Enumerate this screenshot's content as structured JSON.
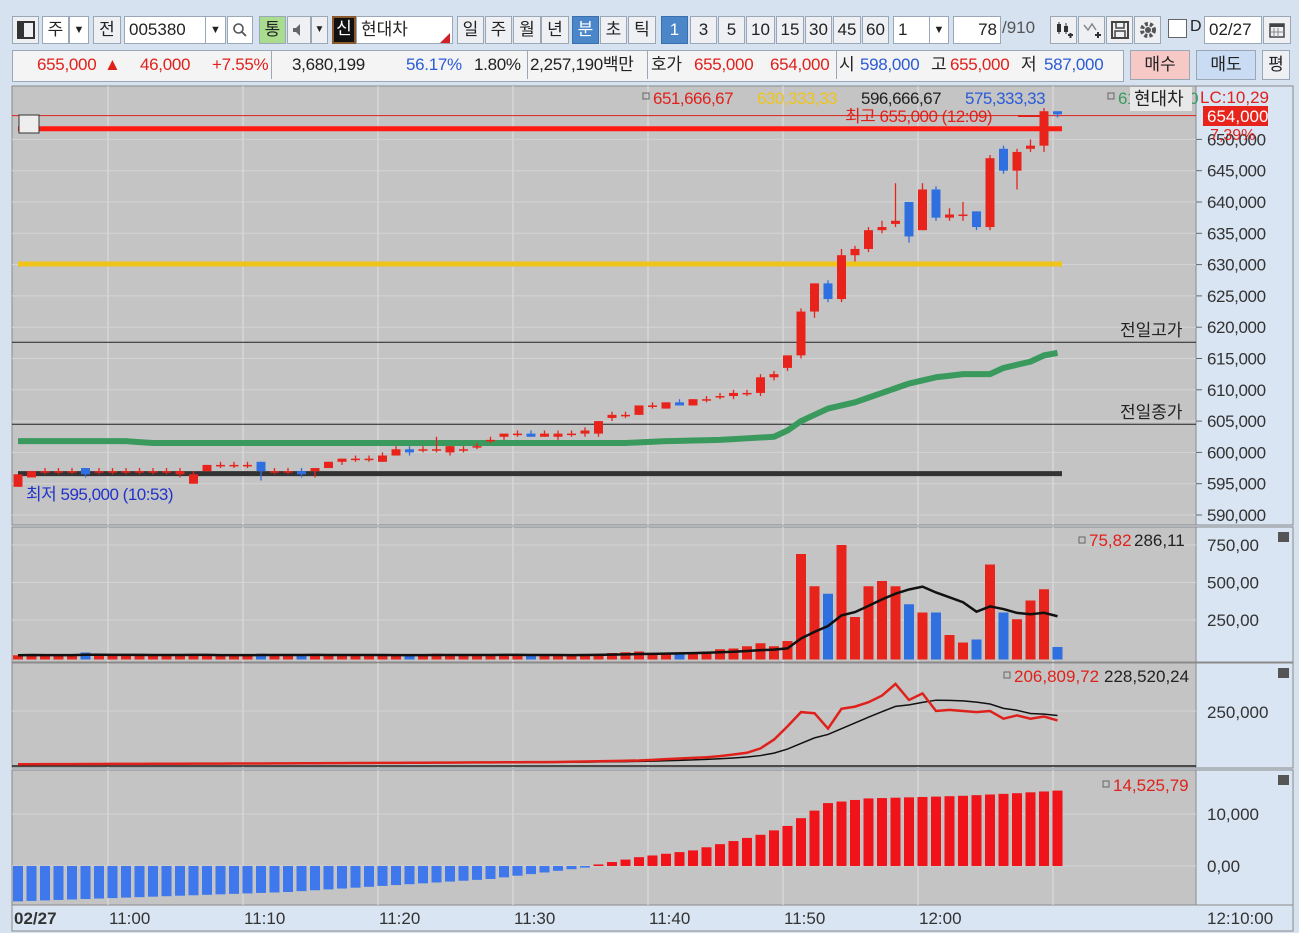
{
  "toolbar": {
    "layout_icon": "window-layout-icon",
    "market_label": "주",
    "prev_label": "전",
    "code_value": "005380",
    "search_icon": "search-icon",
    "tong_label": "통",
    "speaker_icon": "speaker-icon",
    "shin_label": "신",
    "name_value": "현대차",
    "periods": [
      "일",
      "주",
      "월",
      "년",
      "분",
      "초",
      "틱"
    ],
    "active_period": "분",
    "intervals": [
      "1",
      "3",
      "5",
      "10",
      "15",
      "30",
      "45",
      "60"
    ],
    "active_interval": "1",
    "multiplier_value": "1",
    "count_value": "78",
    "count_total": "/910",
    "tool_icons": [
      "add-candle-icon",
      "add-indicator-icon",
      "save-icon",
      "gear-icon"
    ],
    "d_label": "D",
    "date_value": "02/27",
    "calendar_icon": "calendar-icon"
  },
  "quote": {
    "price": "655,000",
    "arrow": "▲",
    "change": "46,000",
    "change_pct": "+7.55%",
    "volume": "3,680,199",
    "vol_ratio": "56.17%",
    "turnover": "1.80%",
    "amount": "2,257,190백만",
    "hoga_label": "호가",
    "ask": "655,000",
    "bid": "654,000",
    "open_label": "시",
    "open": "598,000",
    "high_label": "고",
    "high": "655,000",
    "low_label": "저",
    "low": "587,000",
    "buy_label": "매수",
    "sell_label": "매도",
    "eval_label": "평"
  },
  "colors": {
    "up": "#e8231b",
    "down": "#2f6fe0",
    "ma": "#3a9a5e",
    "yellow": "#f0c419",
    "plot_bg": "#c4c4c4"
  },
  "chart_data": {
    "type": "candlestick",
    "date": "02/27",
    "start_time": "10:53",
    "interval_min": 1,
    "price_axis": {
      "ticks": [
        "590,000",
        "595,000",
        "600,000",
        "605,000",
        "610,000",
        "615,000",
        "620,000",
        "625,000",
        "630,000",
        "635,000",
        "640,000",
        "645,000",
        "650,000"
      ],
      "range": [
        588,
        658
      ],
      "unit": "thousand KRW"
    },
    "time_ticks": [
      "11:00",
      "11:10",
      "11:20",
      "11:30",
      "11:40",
      "11:50",
      "12:00"
    ],
    "time_axis_right": "12:10:00",
    "ohlc": [
      [
        594.5,
        596.5,
        594.5,
        596.5
      ],
      [
        596,
        597,
        596,
        597
      ],
      [
        597,
        597.5,
        596.5,
        597
      ],
      [
        597,
        597.5,
        596.5,
        597
      ],
      [
        597,
        597.5,
        596.5,
        597
      ],
      [
        597.5,
        597.5,
        596,
        596.5
      ],
      [
        597,
        597.5,
        596.5,
        597
      ],
      [
        597,
        597.5,
        596.5,
        597
      ],
      [
        597,
        597.5,
        596.5,
        597
      ],
      [
        597,
        597.5,
        596.5,
        597
      ],
      [
        597,
        597.5,
        596.5,
        597
      ],
      [
        597,
        597.5,
        596.5,
        597
      ],
      [
        596.5,
        597.5,
        596,
        597
      ],
      [
        595,
        597,
        595,
        596.5
      ],
      [
        597,
        598,
        597,
        598
      ],
      [
        598,
        598.5,
        597.5,
        598
      ],
      [
        598,
        598.5,
        597.5,
        598
      ],
      [
        598,
        598.5,
        597.5,
        598
      ],
      [
        598.5,
        598.5,
        595.5,
        597
      ],
      [
        597,
        597.5,
        596.5,
        597
      ],
      [
        597,
        597.5,
        596.5,
        597
      ],
      [
        597,
        597.5,
        596,
        596.5
      ],
      [
        597,
        597.5,
        596,
        597.5
      ],
      [
        597.5,
        598.5,
        597.5,
        598.5
      ],
      [
        598.5,
        599,
        598,
        599
      ],
      [
        599,
        599.5,
        598.5,
        599
      ],
      [
        599,
        599.5,
        598.5,
        599
      ],
      [
        598.5,
        600,
        598.5,
        599.5
      ],
      [
        599.5,
        601,
        599.5,
        600.5
      ],
      [
        600.5,
        601,
        599.5,
        600
      ],
      [
        600.5,
        601,
        600,
        600.5
      ],
      [
        600.5,
        602.5,
        600,
        600.5
      ],
      [
        600,
        601,
        599.5,
        601
      ],
      [
        600.5,
        601,
        600,
        600.5
      ],
      [
        601,
        601.5,
        600.5,
        601
      ],
      [
        602,
        602.5,
        601.5,
        602
      ],
      [
        602.5,
        603,
        602,
        603
      ],
      [
        603,
        603.5,
        602.5,
        603
      ],
      [
        603,
        603.5,
        602.5,
        602.5
      ],
      [
        602.5,
        603.5,
        602.5,
        603
      ],
      [
        602.5,
        603.5,
        602,
        603
      ],
      [
        603,
        603.5,
        602.5,
        603
      ],
      [
        603,
        604,
        602.5,
        603.5
      ],
      [
        603,
        605,
        602.5,
        605
      ],
      [
        605.5,
        606.5,
        605,
        606
      ],
      [
        606,
        606.5,
        605.5,
        606
      ],
      [
        606,
        607.5,
        606,
        607.5
      ],
      [
        607.5,
        608,
        607,
        607.5
      ],
      [
        607,
        608,
        607,
        608
      ],
      [
        608,
        608.5,
        607.5,
        607.5
      ],
      [
        607.5,
        608.5,
        607.5,
        608.5
      ],
      [
        608.5,
        609,
        608,
        608.5
      ],
      [
        609,
        609.5,
        608.5,
        609
      ],
      [
        609,
        610,
        608.5,
        609.5
      ],
      [
        609.5,
        610,
        609,
        609.5
      ],
      [
        609.5,
        612.5,
        609,
        612
      ],
      [
        612,
        613,
        611.5,
        612.5
      ],
      [
        613.5,
        615.5,
        613,
        615.5
      ],
      [
        615.5,
        623,
        615,
        622.5
      ],
      [
        622.5,
        627,
        621.5,
        627
      ],
      [
        627,
        627.5,
        624,
        624.5
      ],
      [
        624.5,
        632.5,
        624,
        631.5
      ],
      [
        631.5,
        633,
        630.5,
        632.5
      ],
      [
        632.5,
        636,
        632,
        635.5
      ],
      [
        635.5,
        637,
        635,
        636
      ],
      [
        636.5,
        643,
        636,
        637
      ],
      [
        640,
        640,
        633.5,
        634.5
      ],
      [
        635.5,
        643,
        635.5,
        642
      ],
      [
        642,
        642.5,
        637,
        637.5
      ],
      [
        637.5,
        639,
        637,
        638
      ],
      [
        638,
        640,
        637,
        638
      ],
      [
        638.5,
        638.5,
        635.5,
        636
      ],
      [
        636,
        647.5,
        635.5,
        647
      ],
      [
        648.5,
        649,
        644.5,
        645
      ],
      [
        645,
        648.5,
        642,
        648
      ],
      [
        648.5,
        650,
        648,
        649
      ],
      [
        649,
        655,
        648,
        654.5
      ],
      [
        654.5,
        654.5,
        653.5,
        654
      ]
    ],
    "ma_keypoints": [
      [
        0,
        601.8
      ],
      [
        8,
        601.8
      ],
      [
        10,
        601.5
      ],
      [
        45,
        601.5
      ],
      [
        48,
        601.8
      ],
      [
        52,
        602
      ],
      [
        56,
        602.5
      ],
      [
        57,
        603.5
      ],
      [
        58,
        605
      ],
      [
        60,
        607
      ],
      [
        62,
        608
      ],
      [
        64,
        609.5
      ],
      [
        66,
        611
      ],
      [
        68,
        612
      ],
      [
        70,
        612.5
      ],
      [
        72,
        612.5
      ],
      [
        73,
        613.5
      ],
      [
        74,
        614
      ],
      [
        75,
        614.5
      ],
      [
        76,
        615.5
      ],
      [
        77,
        615.9
      ]
    ],
    "legend_values": [
      {
        "text": "651,666,67",
        "color": "#e0211b"
      },
      {
        "text": "630,333,33",
        "color": "#f0c419"
      },
      {
        "text": "596,666,67",
        "color": "#222222"
      },
      {
        "text": "575,333,33",
        "color": "#2a5bd7"
      },
      {
        "text": "615,871,40",
        "color": "#3a9a5e"
      }
    ],
    "hlines": [
      {
        "value": 653.8,
        "color": "#e0211b",
        "width": 1
      },
      {
        "value": 651.7,
        "color": "#ff1a12",
        "width": 5
      },
      {
        "value": 630.1,
        "color": "#f0c419",
        "width": 5
      },
      {
        "value": 617.6,
        "color": "#222222",
        "width": 1,
        "label": "전일고가"
      },
      {
        "value": 604.5,
        "color": "#222222",
        "width": 1,
        "label": "전일종가"
      },
      {
        "value": 596.6,
        "color": "#333333",
        "width": 5
      }
    ],
    "annotations": {
      "high": "최고 655,000 (12:09)",
      "low": "최저 595,000 (10:53)",
      "name_tag": "현대차",
      "lc": "LC:10,29",
      "current_price": "654,000",
      "current_pct": "7,39%"
    },
    "volume": {
      "legend": [
        "75,82",
        "286,11"
      ],
      "ticks": [
        "750,00",
        "500,00",
        "250,00"
      ],
      "values": [
        15,
        18,
        15,
        14,
        16,
        33,
        15,
        14,
        16,
        15,
        14,
        15,
        14,
        22,
        15,
        16,
        15,
        14,
        25,
        16,
        15,
        18,
        15,
        16,
        15,
        15,
        14,
        16,
        20,
        18,
        15,
        25,
        16,
        15,
        14,
        16,
        18,
        15,
        16,
        15,
        16,
        18,
        20,
        25,
        30,
        35,
        40,
        30,
        30,
        30,
        35,
        40,
        55,
        60,
        75,
        95,
        75,
        110,
        690,
        475,
        425,
        750,
        270,
        475,
        510,
        475,
        355,
        300,
        300,
        150,
        100,
        120,
        620,
        300,
        255,
        380,
        455,
        70
      ]
    },
    "obv": {
      "legend": [
        "206,809,72",
        "228,520,24"
      ],
      "ticks": [
        "250,000"
      ],
      "keypoints": [
        [
          0,
          8
        ],
        [
          20,
          12
        ],
        [
          40,
          18
        ],
        [
          46,
          25
        ],
        [
          51,
          40
        ],
        [
          52,
          45
        ],
        [
          54,
          60
        ],
        [
          55,
          80
        ],
        [
          56,
          120
        ],
        [
          57,
          180
        ],
        [
          58,
          245
        ],
        [
          59,
          240
        ],
        [
          60,
          170
        ],
        [
          61,
          260
        ],
        [
          62,
          270
        ],
        [
          63,
          290
        ],
        [
          64,
          320
        ],
        [
          65,
          373
        ],
        [
          66,
          300
        ],
        [
          67,
          330
        ],
        [
          68,
          250
        ],
        [
          69,
          255
        ],
        [
          70,
          250
        ],
        [
          71,
          245
        ],
        [
          72,
          250
        ],
        [
          73,
          215
        ],
        [
          74,
          230
        ],
        [
          75,
          215
        ],
        [
          76,
          225
        ],
        [
          77,
          207
        ]
      ]
    },
    "oscillator": {
      "legend": [
        "14,525,79"
      ],
      "ticks": [
        "10,000",
        "0,00"
      ],
      "keypoints": [
        [
          0,
          -6.8
        ],
        [
          20,
          -5
        ],
        [
          35,
          -2.5
        ],
        [
          42,
          -0.3
        ],
        [
          43,
          0.3
        ],
        [
          46,
          1.7
        ],
        [
          50,
          3
        ],
        [
          55,
          6
        ],
        [
          57,
          7.7
        ],
        [
          58,
          9.2
        ],
        [
          60,
          12.1
        ],
        [
          63,
          13
        ],
        [
          66,
          13.2
        ],
        [
          70,
          13.5
        ],
        [
          74,
          14
        ],
        [
          77,
          14.5
        ]
      ]
    }
  }
}
